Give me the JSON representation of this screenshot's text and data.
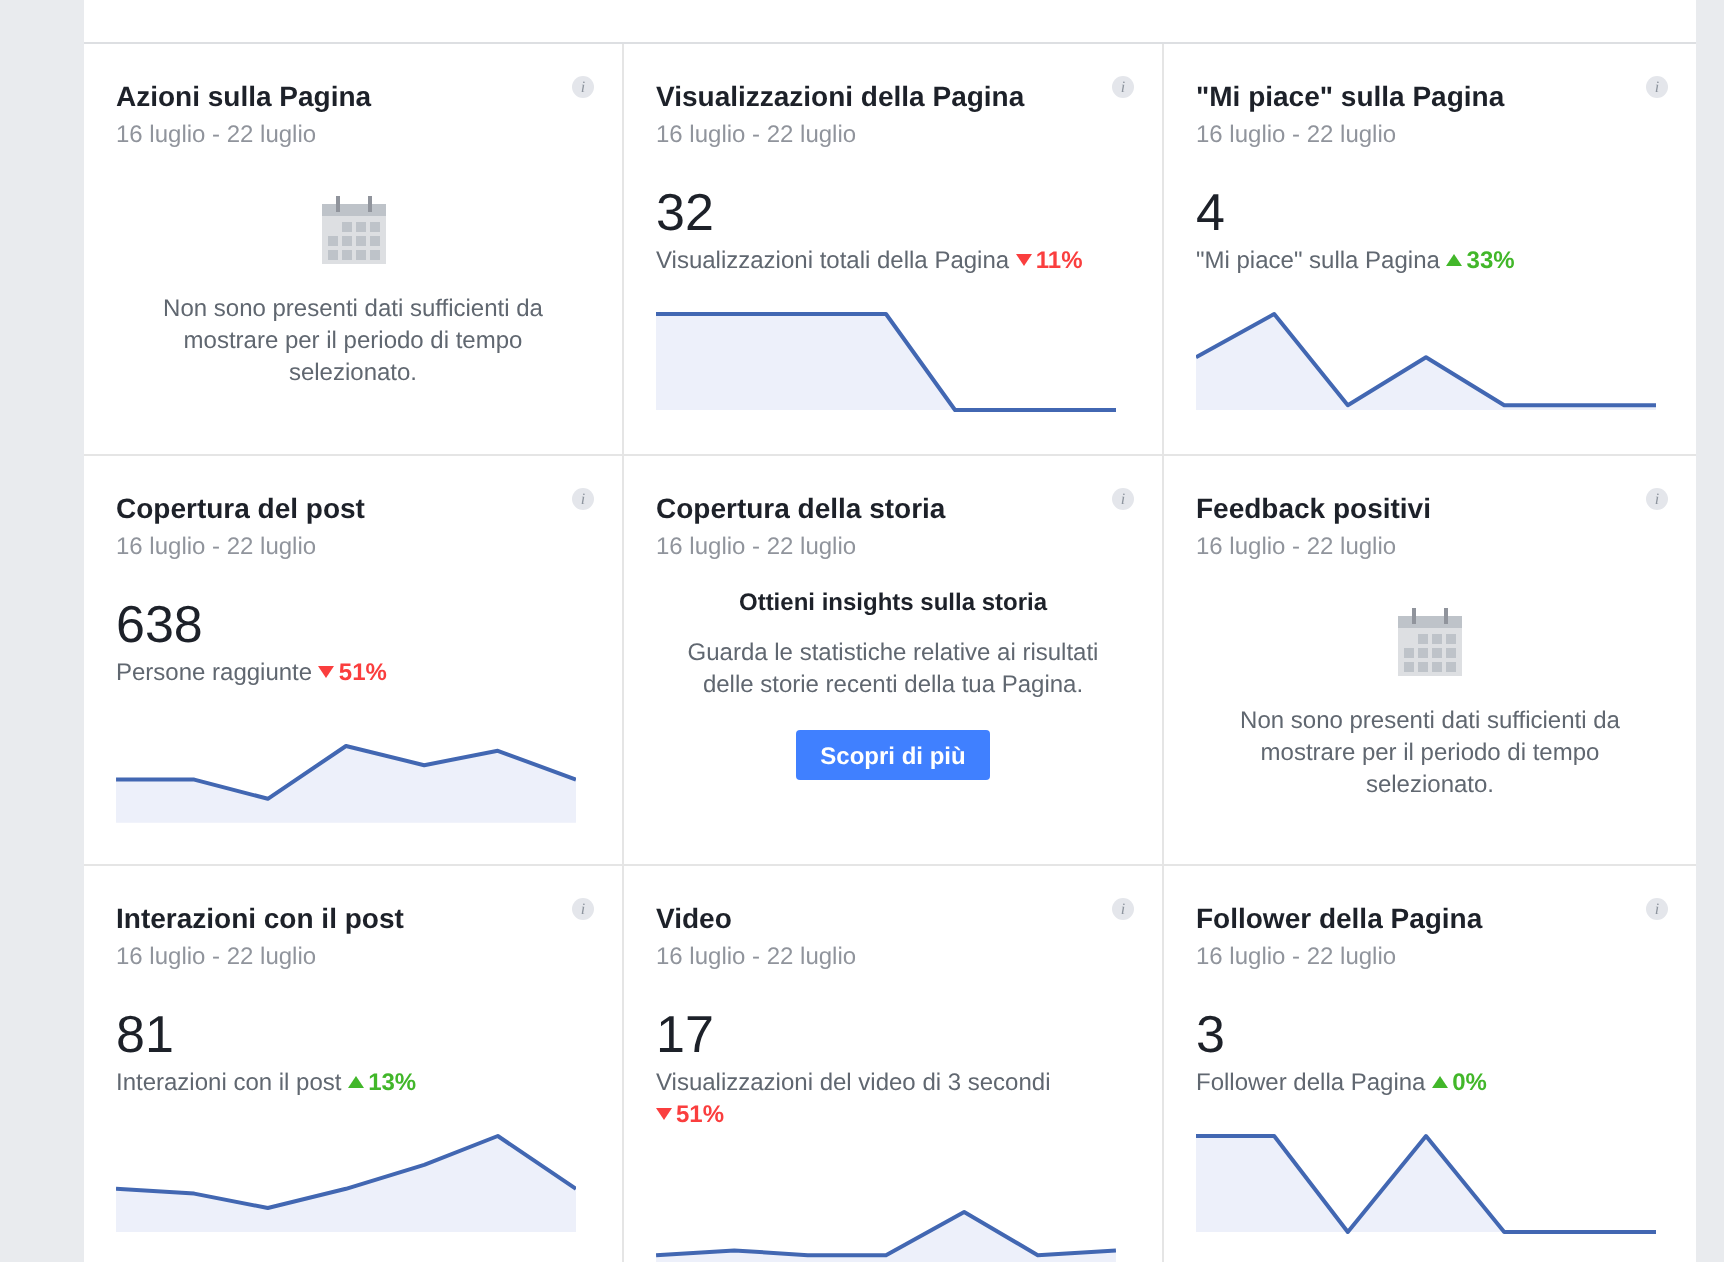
{
  "cards": [
    {
      "kind": "empty",
      "title": "Azioni sulla Pagina",
      "date": "16 luglio - 22 luglio",
      "info": "i",
      "message": "Non sono presenti dati sufficienti da mostrare per il periodo di tempo selezionato."
    },
    {
      "kind": "stat",
      "title": "Visualizzazioni della Pagina",
      "date": "16 luglio - 22 luglio",
      "info": "i",
      "value": "32",
      "label": "Visualizzazioni totali della Pagina",
      "increase": false,
      "change": "11%"
    },
    {
      "kind": "stat",
      "title": "\"Mi piace\" sulla Pagina",
      "date": "16 luglio - 22 luglio",
      "info": "i",
      "value": "4",
      "label": "\"Mi piace\" sulla Pagina",
      "increase": true,
      "change": "33%"
    },
    {
      "kind": "stat",
      "title": "Copertura del post",
      "date": "16 luglio - 22 luglio",
      "info": "i",
      "value": "638",
      "label": "Persone raggiunte",
      "increase": false,
      "change": "51%"
    },
    {
      "kind": "promo",
      "title": "Copertura della storia",
      "date": "16 luglio - 22 luglio",
      "info": "i",
      "heading": "Ottieni insights sulla storia",
      "text": "Guarda le statistiche relative ai risultati delle storie recenti della tua Pagina.",
      "button": "Scopri di più"
    },
    {
      "kind": "empty",
      "title": "Feedback positivi",
      "date": "16 luglio - 22 luglio",
      "info": "i",
      "message": "Non sono presenti dati sufficienti da mostrare per il periodo di tempo selezionato."
    },
    {
      "kind": "stat",
      "title": "Interazioni con il post",
      "date": "16 luglio - 22 luglio",
      "info": "i",
      "value": "81",
      "label": "Interazioni con il post",
      "increase": true,
      "change": "13%"
    },
    {
      "kind": "stat",
      "title": "Video",
      "date": "16 luglio - 22 luglio",
      "info": "i",
      "value": "17",
      "label": "Visualizzazioni del video di 3 secondi",
      "increase": false,
      "change": "51%"
    },
    {
      "kind": "stat",
      "title": "Follower della Pagina",
      "date": "16 luglio - 22 luglio",
      "info": "i",
      "value": "3",
      "label": "Follower della Pagina",
      "increase": true,
      "change": "0%"
    }
  ]
}
